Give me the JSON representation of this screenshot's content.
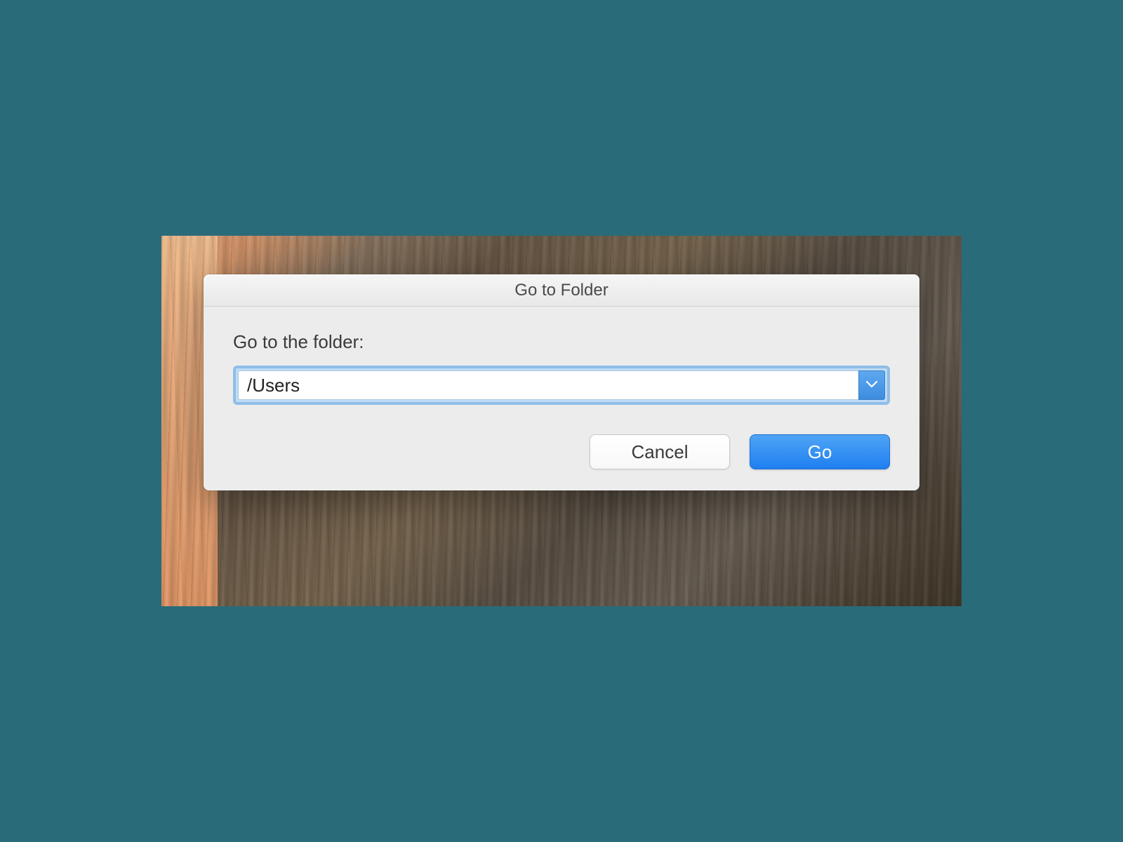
{
  "dialog": {
    "title": "Go to Folder",
    "label": "Go to the folder:",
    "path_value": "/Users",
    "cancel_label": "Cancel",
    "go_label": "Go"
  }
}
